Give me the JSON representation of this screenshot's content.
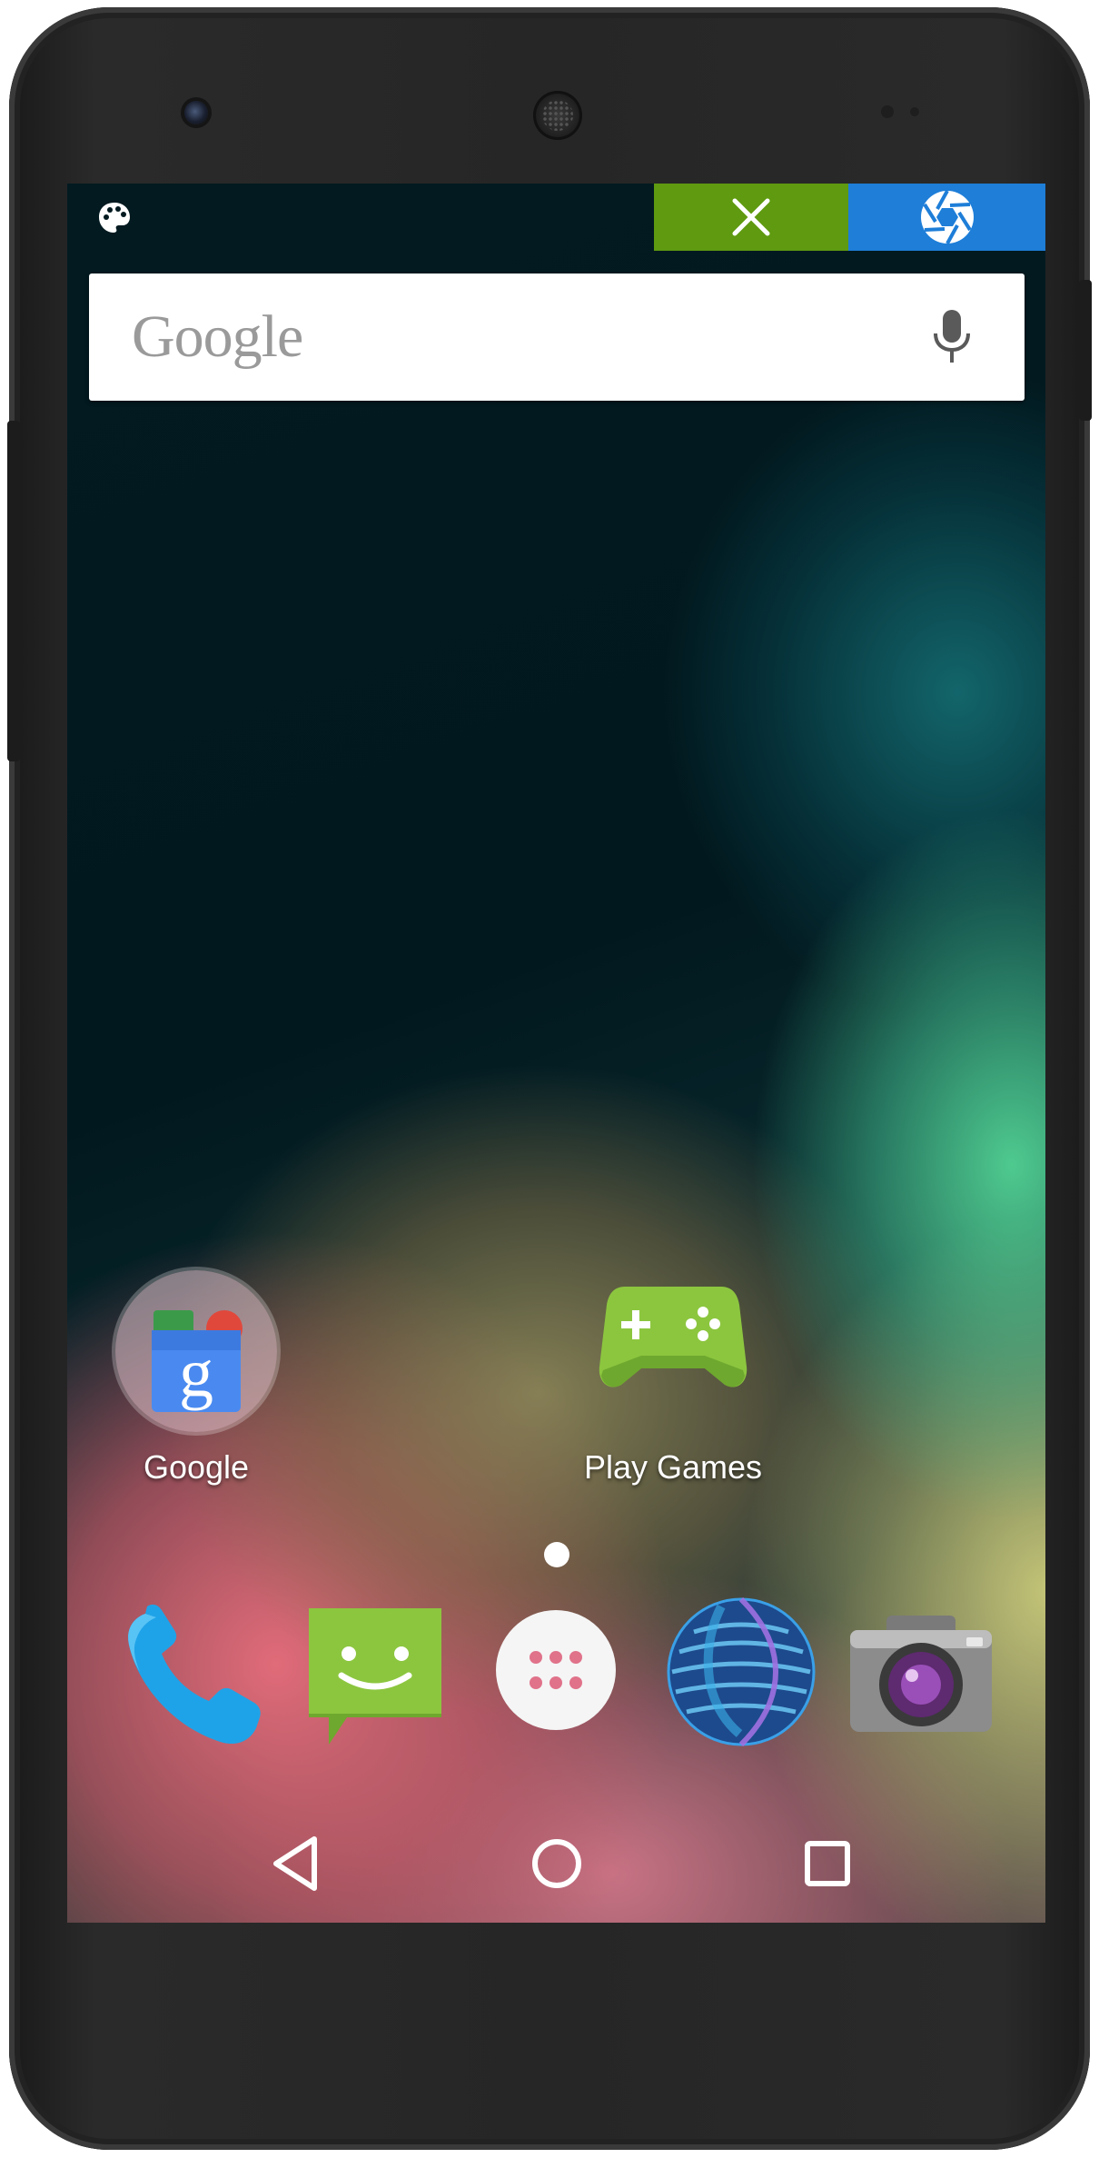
{
  "statusbar": {
    "left_icon": "palette-icon",
    "close_icon": "close-icon",
    "shutter_icon": "shutter-icon",
    "colors": {
      "close_bg": "#5f9a10",
      "shutter_bg": "#1e7ed8"
    }
  },
  "search": {
    "logo_text": "Google",
    "mic_icon": "microphone-icon"
  },
  "home": {
    "apps": [
      {
        "label": "Google",
        "icon": "google-folder-icon"
      },
      {
        "label": "Play Games",
        "icon": "play-games-icon"
      }
    ],
    "page_indicator": {
      "pages": 1,
      "current": 1
    }
  },
  "dock": [
    {
      "name": "phone",
      "icon": "phone-icon"
    },
    {
      "name": "messaging",
      "icon": "messaging-icon"
    },
    {
      "name": "app-drawer",
      "icon": "app-drawer-icon"
    },
    {
      "name": "browser",
      "icon": "globe-icon"
    },
    {
      "name": "camera",
      "icon": "camera-icon"
    }
  ],
  "navbar": {
    "back_icon": "back-icon",
    "home_icon": "home-icon",
    "recents_icon": "recents-icon"
  }
}
